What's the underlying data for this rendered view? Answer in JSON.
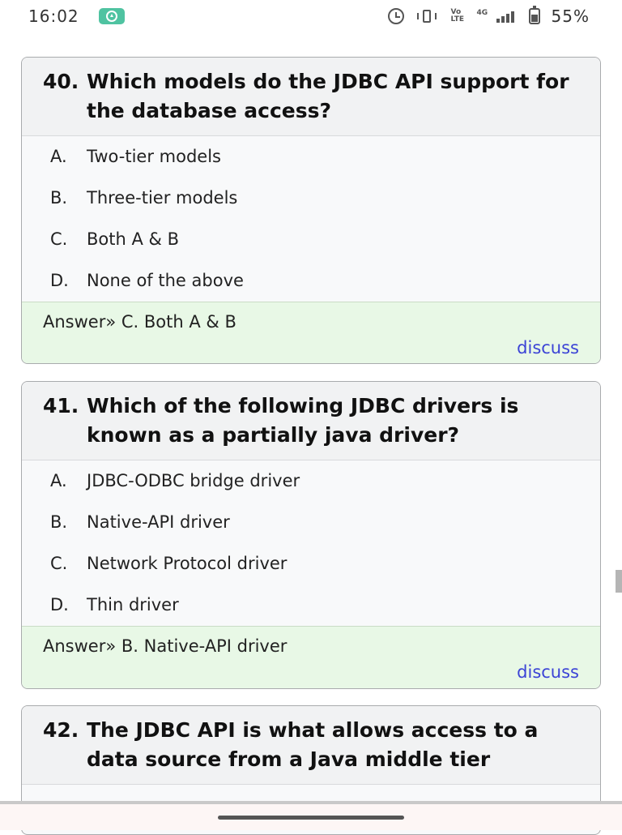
{
  "status_bar": {
    "time": "16:02",
    "battery": "55%",
    "volte": "Vo LTE",
    "network": "4G"
  },
  "questions": [
    {
      "number": "40.",
      "text": "Which models do the JDBC API support for the database access?",
      "options": [
        {
          "letter": "A.",
          "text": "Two-tier models"
        },
        {
          "letter": "B.",
          "text": "Three-tier models"
        },
        {
          "letter": "C.",
          "text": "Both A & B"
        },
        {
          "letter": "D.",
          "text": "None of the above"
        }
      ],
      "answer": "Answer» C. Both A & B",
      "discuss": "discuss"
    },
    {
      "number": "41.",
      "text": "Which of the following JDBC drivers is known as a partially java driver?",
      "options": [
        {
          "letter": "A.",
          "text": "JDBC-ODBC bridge driver"
        },
        {
          "letter": "B.",
          "text": "Native-API driver"
        },
        {
          "letter": "C.",
          "text": "Network Protocol driver"
        },
        {
          "letter": "D.",
          "text": "Thin driver"
        }
      ],
      "answer": "Answer» B. Native-API driver",
      "discuss": "discuss"
    },
    {
      "number": "42.",
      "text": "The JDBC API is what allows access to a data source from a Java middle tier"
    }
  ]
}
